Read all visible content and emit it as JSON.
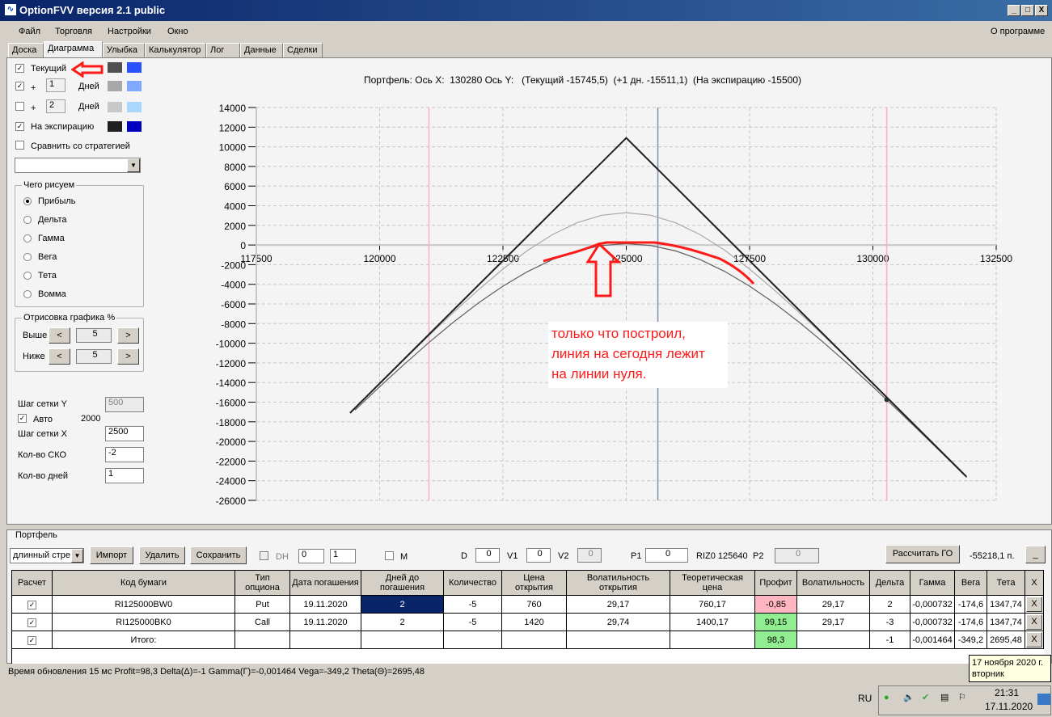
{
  "window": {
    "title": "OptionFVV версия 2.1 public",
    "min": "_",
    "max": "□",
    "close": "X"
  },
  "menu": {
    "items": [
      "Файл",
      "Торговля",
      "Настройки",
      "Окно"
    ],
    "about": "О программе"
  },
  "tabs": [
    "Доска",
    "Диаграмма",
    "Улыбка",
    "Калькулятор",
    "Лог",
    "Данные",
    "Сделки"
  ],
  "left": {
    "current_label": "Текущий",
    "plus": "+",
    "days": "Дней",
    "plus1_value": "1",
    "plus2_value": "2",
    "expiry_label": "На экспирацию",
    "compare_label": "Сравнить со стратегией",
    "colors": {
      "current": [
        "#505050",
        "#2a52ff"
      ],
      "plus1": [
        "#a8a8a8",
        "#7fa8ff"
      ],
      "plus2": [
        "#c8c8c8",
        "#a8d8ff"
      ],
      "expiry": [
        "#202020",
        "#0000c0"
      ]
    },
    "checked": {
      "current": true,
      "plus1": true,
      "plus2": false,
      "expiry": true,
      "compare": false
    },
    "draw_group": "Чего рисуем",
    "draw_options": [
      "Прибыль",
      "Дельта",
      "Гамма",
      "Вега",
      "Тета",
      "Вомма"
    ],
    "draw_selected": "Прибыль",
    "render_group": "Отрисовка графика %",
    "above": "Выше",
    "below": "Ниже",
    "above_val": "5",
    "below_val": "5",
    "prev": "<",
    "next": ">",
    "grid_y_label": "Шаг сетки Y",
    "grid_y_val": "500",
    "auto_label": "Авто",
    "auto_val": "2000",
    "grid_x_label": "Шаг сетки X",
    "grid_x_val": "2500",
    "sko_label": "Кол-во СКО",
    "sko_val": "-2",
    "days_label": "Кол-во дней",
    "days_val": "1"
  },
  "chart_data": {
    "type": "line",
    "title": "Портфель: Ось X:  130280 Ось Y:   (Текущий -15745,5)  (+1 дн. -15511,1)  (На экспирацию -15500)",
    "xlim": [
      117500,
      132500
    ],
    "ylim": [
      -26000,
      14000
    ],
    "xtick_step": 2500,
    "ytick_step": 2000,
    "grid": true,
    "series": [
      {
        "name": "Текущий",
        "color": "#606060",
        "x": [
          119500,
          120000,
          120500,
          121000,
          121500,
          122000,
          122500,
          123000,
          123500,
          124000,
          124500,
          125000,
          125500,
          126000,
          126500,
          127000,
          127500,
          128000,
          128500,
          129000,
          129500,
          130000,
          130500,
          131000,
          131500,
          131900
        ],
        "y": [
          -16805,
          -14435,
          -12135,
          -9925,
          -7840,
          -5910,
          -4185,
          -2700,
          -1490,
          -600,
          -52,
          135,
          -52,
          -600,
          -1490,
          -2700,
          -4185,
          -5910,
          -7840,
          -9925,
          -12135,
          -14435,
          -16805,
          -19225,
          -21670,
          -23660
        ]
      },
      {
        "name": "+1 дн.",
        "color": "#a8a8a8",
        "x": [
          119500,
          120000,
          120500,
          121000,
          121500,
          122000,
          122500,
          123000,
          123500,
          124000,
          124500,
          125000,
          125500,
          126000,
          126500,
          127000,
          127500,
          128000,
          128500,
          129000,
          129500,
          130000,
          130500,
          131000,
          131500,
          131900
        ],
        "y": [
          -16610,
          -14125,
          -11655,
          -9220,
          -6845,
          -4575,
          -2450,
          -545,
          1050,
          2265,
          3030,
          3290,
          3030,
          2265,
          1050,
          -545,
          -2450,
          -4575,
          -6845,
          -9220,
          -11655,
          -14125,
          -16610,
          -19103,
          -21600,
          -23600
        ]
      },
      {
        "name": "На экспирацию",
        "color": "#202020",
        "x": [
          119400,
          125000,
          131900
        ],
        "y": [
          -17100,
          10900,
          -23600
        ]
      }
    ],
    "vlines": [
      {
        "x": 121000,
        "color": "#ffb0c0"
      },
      {
        "x": 125640,
        "color": "#8090b0"
      },
      {
        "x": 130280,
        "color": "#ffb0c0"
      }
    ],
    "marker": {
      "x": 130280,
      "y": -15745.5
    }
  },
  "annotation": {
    "text1": "только что построил,",
    "text2": "линия на сегодня лежит",
    "text3": "на линии нуля.",
    "color": "#ff1a1a"
  },
  "portfolio": {
    "group": "Портфель",
    "strategy": "длинный стре",
    "import": "Импорт",
    "delete": "Удалить",
    "save": "Сохранить",
    "dh": "DH",
    "dh1": "0",
    "dh2": "1",
    "m": "M",
    "d_label": "D",
    "d_val": "0",
    "v1_label": "V1",
    "v1_val": "0",
    "v2_label": "V2",
    "v2_val": "0",
    "p1_label": "P1",
    "p1_val": "0",
    "riz": "RIZ0 125640",
    "p2_label": "P2",
    "p2_val": "0",
    "calc_go": "Рассчитать ГО",
    "go_value": "-55218,1 п.",
    "collapse": "_",
    "columns": [
      "Расчет",
      "Код бумаги",
      "Тип опциона",
      "Дата погашения",
      "Дней до погашения",
      "Количество",
      "Цена открытия",
      "Волатильность открытия",
      "Теоретическая цена",
      "Профит",
      "Волатильность",
      "Дельта",
      "Гамма",
      "Вега",
      "Тета",
      "X"
    ],
    "rows": [
      [
        "✓",
        "RI125000BW0",
        "Put",
        "19.11.2020",
        "2",
        "-5",
        "760",
        "29,17",
        "760,17",
        "-0,85",
        "29,17",
        "2",
        "-0,000732",
        "-174,6",
        "1347,74",
        "X"
      ],
      [
        "✓",
        "RI125000BK0",
        "Call",
        "19.11.2020",
        "2",
        "-5",
        "1420",
        "29,74",
        "1400,17",
        "99,15",
        "29,17",
        "-3",
        "-0,000732",
        "-174,6",
        "1347,74",
        "X"
      ],
      [
        "✓",
        "Итого:",
        "",
        "",
        "",
        "",
        "",
        "",
        "",
        "98,3",
        "",
        "-1",
        "-0,001464",
        "-349,2",
        "2695,48",
        "X"
      ]
    ],
    "profit_colors": [
      "#ffb6c1",
      "#90ee90",
      "#90ee90"
    ]
  },
  "status": "Время обновления 15 мс  Profit=98,3 Delta(Δ)=-1 Gamma(Γ)=-0,001464 Vega=-349,2 Theta(Θ)=2695,48",
  "tooltip": {
    "line1": "17 ноября 2020 г.",
    "line2": "вторник"
  },
  "taskbar": {
    "lang": "RU",
    "time": "21:31",
    "date": "17.11.2020"
  }
}
